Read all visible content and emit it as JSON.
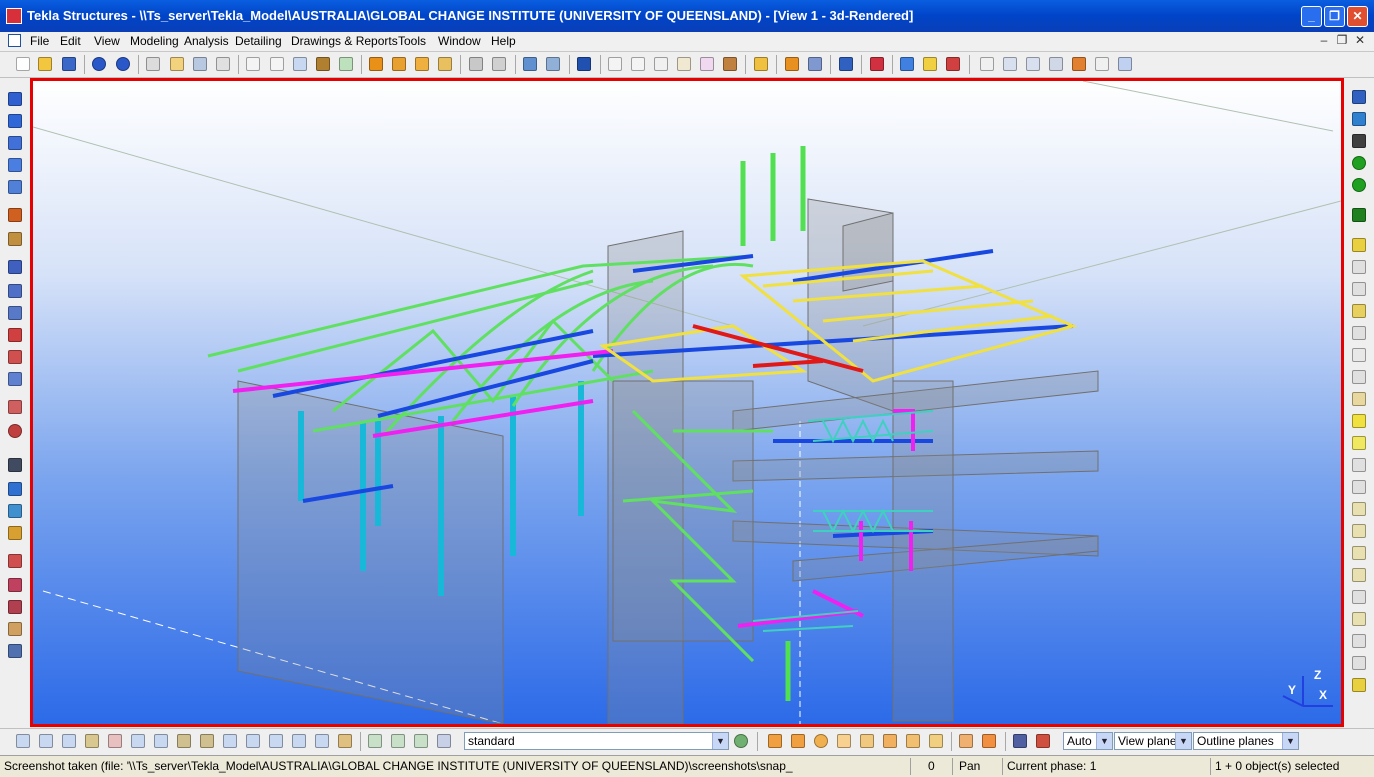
{
  "window": {
    "title": "Tekla Structures - \\\\Ts_server\\Tekla_Model\\AUSTRALIA\\GLOBAL CHANGE INSTITUTE (UNIVERSITY OF QUEENSLAND) - [View 1 - 3d-Rendered]",
    "minimize": "_",
    "restore": "❐",
    "close": "✕"
  },
  "menu": {
    "items": [
      "File",
      "Edit",
      "View",
      "Modeling",
      "Analysis",
      "Detailing",
      "Drawings & Reports",
      "Tools",
      "Window",
      "Help"
    ],
    "mdi_minimize": "–",
    "mdi_restore": "❐",
    "mdi_close": "✕"
  },
  "bottom_toolbar": {
    "filter_value": "standard",
    "render_value": "Auto",
    "view_plane_value": "View plane",
    "outline_value": "Outline planes"
  },
  "viewport": {
    "axis_x": "X",
    "axis_y": "Y",
    "axis_z": "Z"
  },
  "status": {
    "message": "Screenshot taken (file: '\\\\Ts_server\\Tekla_Model\\AUSTRALIA\\GLOBAL CHANGE INSTITUTE (UNIVERSITY OF QUEENSLAND)\\screenshots\\snap_",
    "count": "0",
    "mode": "Pan",
    "phase": "Current phase: 1",
    "selection": "1 + 0 object(s) selected"
  }
}
